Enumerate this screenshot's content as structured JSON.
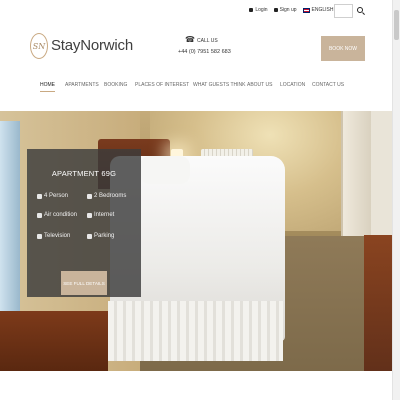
{
  "topbar": {
    "login": "Login",
    "signup": "Sign up",
    "language": "ENGLISH",
    "search_placeholder": ""
  },
  "header": {
    "logo_mark": "SN",
    "logo_text": "StayNorwich",
    "call_label": "CALL US",
    "call_number": "+44 (0) 7951 582 683",
    "book_button": "BOOK NOW"
  },
  "nav": {
    "items": [
      {
        "label": "HOME",
        "active": true
      },
      {
        "label": "APARTMENTS"
      },
      {
        "label": "BOOKING"
      },
      {
        "label": "PLACES OF INTEREST"
      },
      {
        "label": "WHAT GUESTS THINK"
      },
      {
        "label": "ABOUT US"
      },
      {
        "label": "LOCATION"
      },
      {
        "label": "CONTACT US"
      }
    ]
  },
  "hero": {
    "card": {
      "title": "APARTMENT 69G",
      "features": [
        {
          "icon": "person-icon",
          "label": "4 Person"
        },
        {
          "icon": "bed-icon",
          "label": "2 Bedrooms"
        },
        {
          "icon": "air-condition-icon",
          "label": "Air condition"
        },
        {
          "icon": "wifi-icon",
          "label": "Internet"
        },
        {
          "icon": "television-icon",
          "label": "Television"
        },
        {
          "icon": "parking-icon",
          "label": "Parking"
        }
      ],
      "button": "SEE FULL DETAILS"
    }
  },
  "colors": {
    "accent": "#c9b49b",
    "card_bg": "#3c3c3c"
  }
}
